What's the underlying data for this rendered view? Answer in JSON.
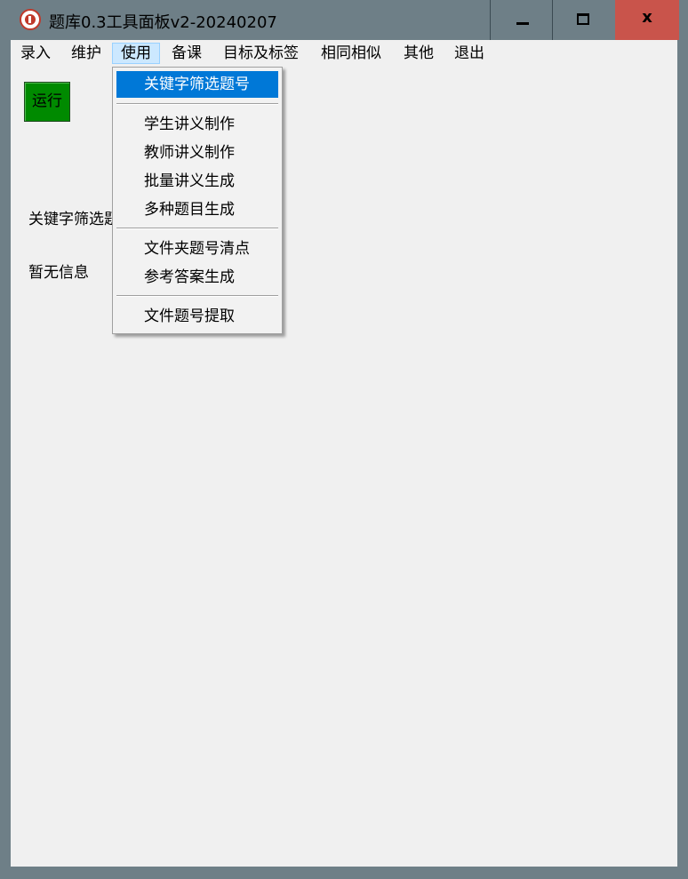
{
  "window": {
    "title": "题库0.3工具面板v2-20240207",
    "close_label": "x"
  },
  "menubar": {
    "items": [
      "录入",
      "维护",
      "使用",
      "备课",
      "目标及标签",
      "相同相似",
      "其他",
      "退出"
    ],
    "active": "使用"
  },
  "dropdown": {
    "items": [
      "关键字筛选题号",
      "学生讲义制作",
      "教师讲义制作",
      "批量讲义生成",
      "多种题目生成",
      "文件夹题号清点",
      "参考答案生成",
      "文件题号提取"
    ],
    "highlighted": "关键字筛选题号"
  },
  "main": {
    "run_button": "运行",
    "mode_label": "关键字筛选题号",
    "status_text": "暂无信息"
  },
  "colors": {
    "chrome": "#6e7f87",
    "close_button": "#c9544b",
    "run_button": "#008a00",
    "menu_highlight": "#0078d7"
  }
}
